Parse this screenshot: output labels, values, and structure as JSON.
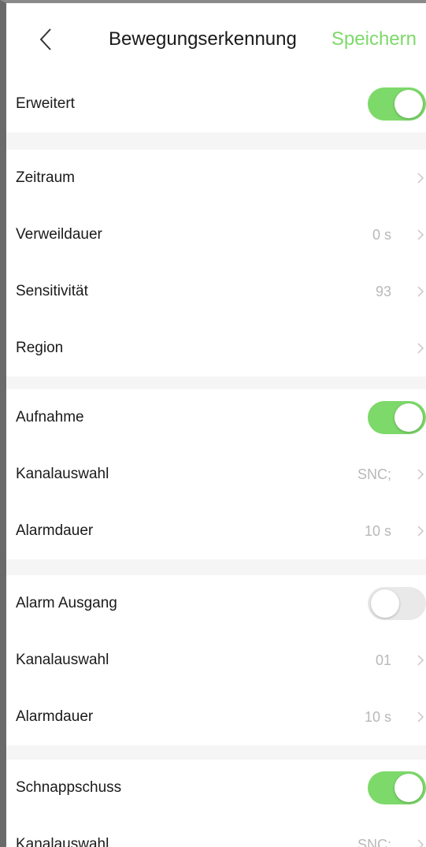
{
  "header": {
    "title": "Bewegungserkennung",
    "save_label": "Speichern",
    "back_icon": "chevron-left-icon"
  },
  "colors": {
    "accent": "#7dd96a",
    "toggle_off": "#e9e9e9",
    "value_text": "#b8b8b8",
    "separator": "#f5f5f5"
  },
  "sections": {
    "advanced": {
      "label": "Erweitert",
      "enabled": true
    },
    "settings": {
      "period_label": "Zeitraum",
      "dwell_label": "Verweildauer",
      "dwell_value": "0 s",
      "sensitivity_label": "Sensitivität",
      "sensitivity_value": "93",
      "region_label": "Region"
    },
    "recording": {
      "label": "Aufnahme",
      "enabled": true,
      "channel_label": "Kanalauswahl",
      "channel_value": "SNC;",
      "duration_label": "Alarmdauer",
      "duration_value": "10 s"
    },
    "alarm_output": {
      "label": "Alarm Ausgang",
      "enabled": false,
      "channel_label": "Kanalauswahl",
      "channel_value": "01",
      "duration_label": "Alarmdauer",
      "duration_value": "10 s"
    },
    "snapshot": {
      "label": "Schnappschuss",
      "enabled": true,
      "channel_label": "Kanalauswahl",
      "channel_value": "SNC;"
    }
  }
}
